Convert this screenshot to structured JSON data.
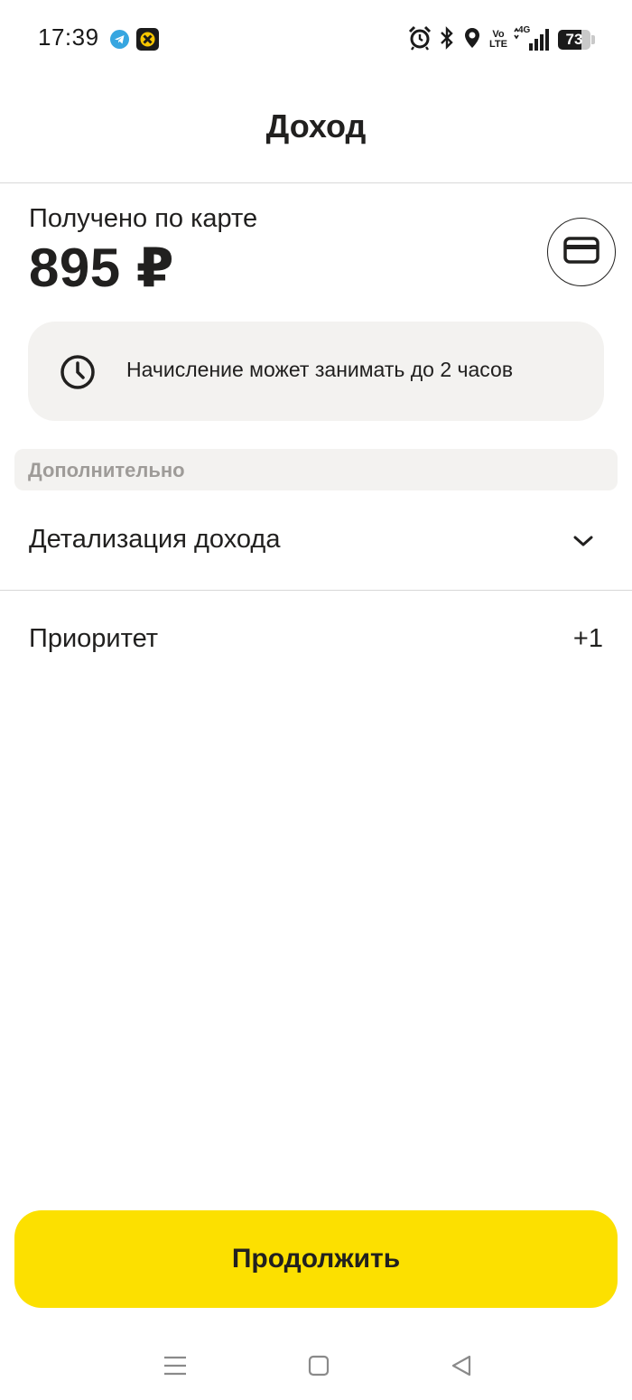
{
  "status_bar": {
    "time": "17:39",
    "network_label_top": "Vo",
    "network_label_bottom": "LTE",
    "network_type": "4G",
    "battery_level": "73",
    "battery_fraction": 0.73,
    "icons": [
      "telegram-icon",
      "app-notification-icon",
      "alarm-icon",
      "bluetooth-icon",
      "location-icon",
      "volte-icon",
      "signal-icon",
      "battery-icon"
    ]
  },
  "header": {
    "title": "Доход"
  },
  "income": {
    "label": "Получено по карте",
    "amount": "895 ₽",
    "card_icon": "card-icon"
  },
  "notice": {
    "icon": "clock-icon",
    "text": "Начисление может занимать до 2 часов"
  },
  "section": {
    "label": "Дополнительно"
  },
  "details": {
    "label": "Детализация дохода",
    "icon": "chevron-down-icon"
  },
  "priority": {
    "label": "Приоритет",
    "value": "+1"
  },
  "continue_button": {
    "label": "Продолжить"
  },
  "colors": {
    "accent": "#fce000",
    "text": "#21201f",
    "muted": "#9e9b98",
    "panel": "#f3f2f0"
  },
  "nav": {
    "icons": [
      "menu-icon",
      "home-icon",
      "back-icon"
    ]
  }
}
